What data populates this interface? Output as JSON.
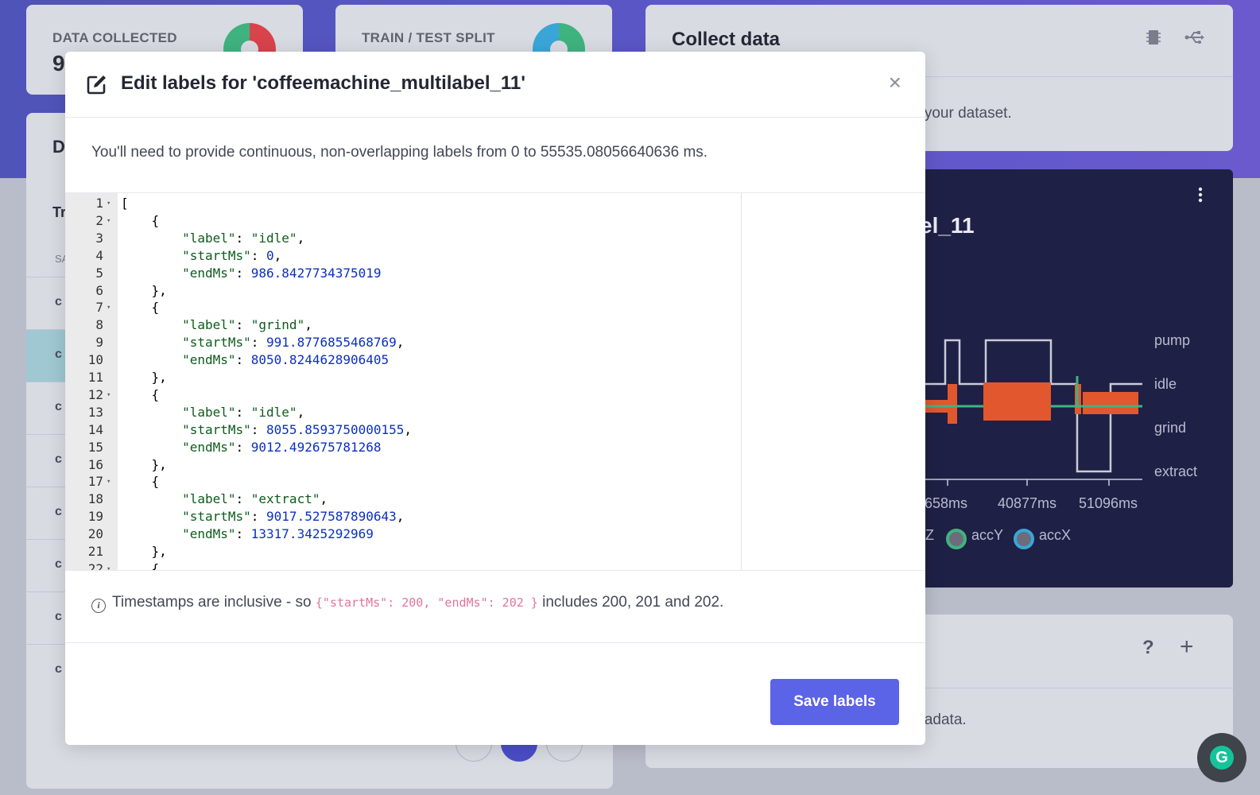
{
  "background": {
    "stat_cards": [
      {
        "label": "DATA COLLECTED",
        "value": "9"
      },
      {
        "label": "TRAIN / TEST SPLIT",
        "value": ""
      }
    ],
    "collect": {
      "title": "Collect data",
      "subtitle_fragment": "g your dataset."
    },
    "left_panel": {
      "heading_fragment": "D",
      "tab_fragment": "Tr",
      "col_fragment": "SA",
      "row_fragment": "c"
    },
    "sample": {
      "title_fragment": "el_11",
      "y_labels": [
        "pump",
        "idle",
        "grind",
        "extract"
      ],
      "x_labels": [
        "0658ms",
        "40877ms",
        "51096ms"
      ],
      "legend": [
        "Z",
        "accY",
        "accX"
      ]
    },
    "metadata_fragment": "etadata."
  },
  "modal": {
    "title": "Edit labels for 'coffeemachine_multilabel_11'",
    "description": "You'll need to provide continuous, non-overlapping labels from 0 to 55535.08056640636 ms.",
    "note_prefix": "Timestamps are inclusive - so",
    "note_code": "{\"startMs\": 200, \"endMs\": 202 }",
    "note_suffix": "includes 200, 201 and 202.",
    "save_label": "Save labels",
    "close_glyph": "×",
    "code_lines": [
      {
        "n": "1",
        "fold": true,
        "text": "["
      },
      {
        "n": "2",
        "fold": true,
        "text": "    {"
      },
      {
        "n": "3",
        "fold": false,
        "text": "        \"label\": \"idle\","
      },
      {
        "n": "4",
        "fold": false,
        "text": "        \"startMs\": 0,"
      },
      {
        "n": "5",
        "fold": false,
        "text": "        \"endMs\": 986.8427734375019"
      },
      {
        "n": "6",
        "fold": false,
        "text": "    },"
      },
      {
        "n": "7",
        "fold": true,
        "text": "    {"
      },
      {
        "n": "8",
        "fold": false,
        "text": "        \"label\": \"grind\","
      },
      {
        "n": "9",
        "fold": false,
        "text": "        \"startMs\": 991.8776855468769,"
      },
      {
        "n": "10",
        "fold": false,
        "text": "        \"endMs\": 8050.8244628906405"
      },
      {
        "n": "11",
        "fold": false,
        "text": "    },"
      },
      {
        "n": "12",
        "fold": true,
        "text": "    {"
      },
      {
        "n": "13",
        "fold": false,
        "text": "        \"label\": \"idle\","
      },
      {
        "n": "14",
        "fold": false,
        "text": "        \"startMs\": 8055.8593750000155,"
      },
      {
        "n": "15",
        "fold": false,
        "text": "        \"endMs\": 9012.492675781268"
      },
      {
        "n": "16",
        "fold": false,
        "text": "    },"
      },
      {
        "n": "17",
        "fold": true,
        "text": "    {"
      },
      {
        "n": "18",
        "fold": false,
        "text": "        \"label\": \"extract\","
      },
      {
        "n": "19",
        "fold": false,
        "text": "        \"startMs\": 9017.527587890643,"
      },
      {
        "n": "20",
        "fold": false,
        "text": "        \"endMs\": 13317.3425292969"
      },
      {
        "n": "21",
        "fold": false,
        "text": "    },"
      },
      {
        "n": "22",
        "fold": true,
        "text": "    {"
      }
    ]
  },
  "colors": {
    "accent": "#5b63e6",
    "header_band": "#5c57c9",
    "dark_panel": "#1f2045",
    "series_accZ": "#e2572e",
    "series_accY": "#3fb37f",
    "series_accX": "#3aa6d8"
  },
  "icons": [
    "edit-icon",
    "close-icon",
    "info-icon",
    "chip-icon",
    "usb-icon",
    "kebab-icon",
    "help-icon",
    "plus-icon",
    "grammarly-icon"
  ]
}
